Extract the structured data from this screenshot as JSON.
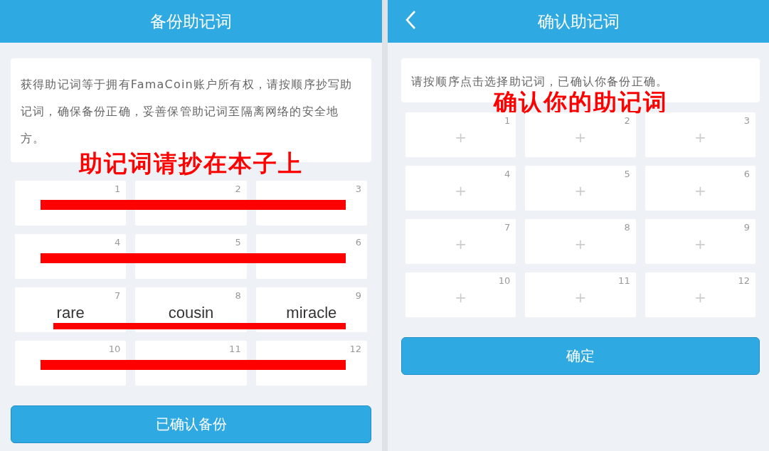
{
  "screens": [
    {
      "title": "备份助记词",
      "back": false,
      "notice": "获得助记词等于拥有FamaCoin账户所有权，请按顺序抄写助记词，确保备份正确，妥善保管助记词至隔离网络的安全地方。",
      "annotation": "助记词请抄在本子上",
      "rows": [
        {
          "redacted": true,
          "cells": [
            {
              "kind": "word",
              "number": "1"
            },
            {
              "kind": "word",
              "number": "2"
            },
            {
              "kind": "word",
              "number": "3"
            }
          ]
        },
        {
          "redacted": true,
          "cells": [
            {
              "kind": "word",
              "number": "4"
            },
            {
              "kind": "word",
              "number": "5"
            },
            {
              "kind": "word",
              "number": "6"
            }
          ]
        },
        {
          "redacted": true,
          "cells": [
            {
              "kind": "word",
              "number": "7",
              "text": "rare"
            },
            {
              "kind": "word",
              "number": "8",
              "text": "cousin"
            },
            {
              "kind": "word",
              "number": "9",
              "text": "miracle"
            }
          ]
        },
        {
          "redacted": true,
          "cells": [
            {
              "kind": "word",
              "number": "10"
            },
            {
              "kind": "word",
              "number": "11"
            },
            {
              "kind": "word",
              "number": "12"
            }
          ]
        }
      ],
      "button": "已确认备份"
    },
    {
      "title": "确认助记词",
      "back": true,
      "notice": "请按顺序点击选择助记词，已确认你备份正确。",
      "annotation": "确认你的助记词",
      "rows": [
        {
          "redacted": false,
          "cells": [
            {
              "kind": "slot",
              "number": "1",
              "text": "+"
            },
            {
              "kind": "slot",
              "number": "2",
              "text": "+"
            },
            {
              "kind": "slot",
              "number": "3",
              "text": "+"
            }
          ]
        },
        {
          "redacted": false,
          "cells": [
            {
              "kind": "slot",
              "number": "4",
              "text": "+"
            },
            {
              "kind": "slot",
              "number": "5",
              "text": "+"
            },
            {
              "kind": "slot",
              "number": "6",
              "text": "+"
            }
          ]
        },
        {
          "redacted": false,
          "cells": [
            {
              "kind": "slot",
              "number": "7",
              "text": "+"
            },
            {
              "kind": "slot",
              "number": "8",
              "text": "+"
            },
            {
              "kind": "slot",
              "number": "9",
              "text": "+"
            }
          ]
        },
        {
          "redacted": false,
          "cells": [
            {
              "kind": "slot",
              "number": "10",
              "text": "+"
            },
            {
              "kind": "slot",
              "number": "11",
              "text": "+"
            },
            {
              "kind": "slot",
              "number": "12",
              "text": "+"
            }
          ]
        }
      ],
      "button": "确定"
    }
  ]
}
